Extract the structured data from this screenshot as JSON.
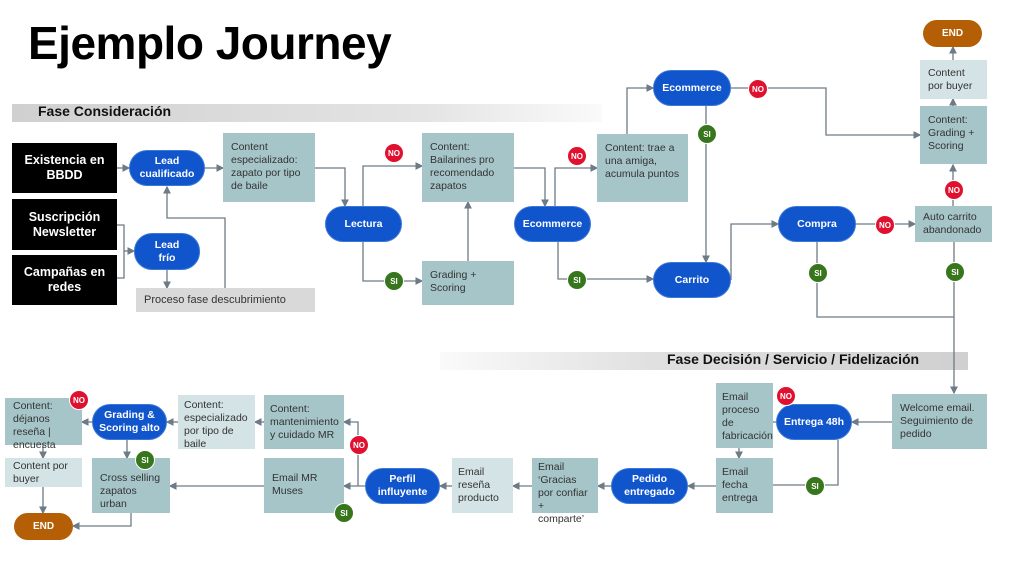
{
  "title": "Ejemplo Journey",
  "phases": {
    "consideracion": "Fase Consideración",
    "decision": "Fase Decisión / Servicio / Fidelización"
  },
  "colors": {
    "node_blue": "#1155cc",
    "box_teal": "#a6c5c8",
    "box_light": "#d4e4e6",
    "end": "#b45f06",
    "no": "#e0102f",
    "si": "#38761d",
    "connector": "#6d7b86"
  },
  "labels": {
    "no": "NO",
    "si": "SI",
    "end": "END"
  },
  "top": {
    "existencia": "Existencia en BBDD",
    "suscripcion": "Suscripción Newsletter",
    "campanas": "Campañas en redes",
    "lead_cualificado": "Lead cualificado",
    "lead_frio": "Lead frío",
    "proceso": "Proceso fase descubrimiento",
    "content_especializado": "Content especializado: zapato por tipo de baile",
    "lectura": "Lectura",
    "content_bailarines": "Content: Bailarines pro recomendado zapatos",
    "grading_scoring": "Grading + Scoring",
    "ecommerce1": "Ecommerce",
    "content_trae": "Content: trae a una amiga, acumula puntos",
    "ecommerce2": "Ecommerce",
    "carrito": "Carrito",
    "compra": "Compra",
    "auto_carrito": "Auto carrito abandonado",
    "content_grading": "Content: Grading + Scoring",
    "content_buyer": "Content por buyer"
  },
  "bottom": {
    "welcome": "Welcome email. Seguimiento de pedido",
    "entrega": "Entrega 48h",
    "email_proceso": "Email proceso de fabricación",
    "email_fecha": "Email fecha entrega",
    "pedido": "Pedido entregado",
    "email_gracias": "Email ‘Gracias por confiar + comparte’",
    "email_resena": "Email reseña producto",
    "perfil": "Perfil influyente",
    "email_muses": "Email MR Muses",
    "content_mantenimiento": "Content: mantenimiento y cuidado MR",
    "content_especializado": "Content: especializado por tipo de baile",
    "grading_alto": "Grading & Scoring alto",
    "cross_selling": "Cross selling zapatos urban",
    "content_dejanos": "Content: déjanos reseña | encuesta",
    "content_buyer": "Content por buyer"
  }
}
